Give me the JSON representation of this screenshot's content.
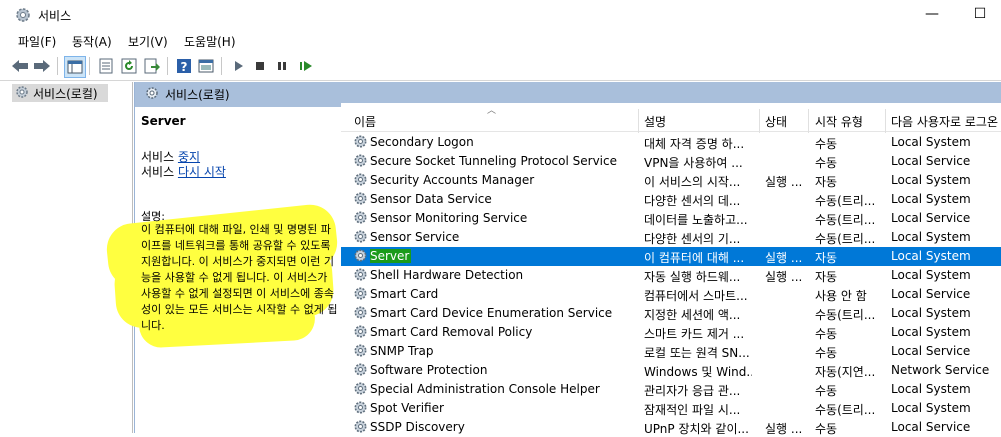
{
  "window": {
    "title": "서비스",
    "minimize": "—",
    "maximize": "☐"
  },
  "menu": [
    "파일(F)",
    "동작(A)",
    "보기(V)",
    "도움말(H)"
  ],
  "toolbar_icons": [
    "back-arrow-icon",
    "forward-arrow-icon",
    "console-tree-icon",
    "properties-icon",
    "refresh-icon",
    "export-icon",
    "help-icon",
    "view-icon",
    "play-icon",
    "stop-icon",
    "pause-icon",
    "resume-icon"
  ],
  "tree": {
    "item": "서비스(로컬)"
  },
  "pane": {
    "header": "서비스(로컬)"
  },
  "details": {
    "title": "Server",
    "line1_prefix": "서비스 ",
    "line1_link": "중지",
    "line2_prefix": "서비스 ",
    "line2_link": "다시 시작",
    "desc_label": "설명:",
    "desc_text": "이 컴퓨터에 대해 파일, 인쇄 및 명명된 파이프를 네트워크를 통해 공유할 수 있도록 지원합니다. 이 서비스가 중지되면 이런 기능을 사용할 수 없게 됩니다. 이 서비스가 사용할 수 없게 설정되면 이 서비스에 종속성이 있는 모든 서비스는 시작할 수 없게 됩니다."
  },
  "list": {
    "headers": {
      "name": "이름",
      "desc": "설명",
      "status": "상태",
      "start": "시작 유형",
      "logon": "다음 사용자로 로그온"
    },
    "rows": [
      {
        "name": "Secondary Logon",
        "desc": "대체 자격 증명 하...",
        "status": "",
        "start": "수동",
        "logon": "Local System"
      },
      {
        "name": "Secure Socket Tunneling Protocol Service",
        "desc": "VPN을 사용하여 ...",
        "status": "",
        "start": "수동",
        "logon": "Local Service"
      },
      {
        "name": "Security Accounts Manager",
        "desc": "이 서비스의 시작...",
        "status": "실행 ...",
        "start": "자동",
        "logon": "Local System"
      },
      {
        "name": "Sensor Data Service",
        "desc": "다양한 센서의 데...",
        "status": "",
        "start": "수동(트리...",
        "logon": "Local System"
      },
      {
        "name": "Sensor Monitoring Service",
        "desc": "데이터를 노출하고...",
        "status": "",
        "start": "수동(트리...",
        "logon": "Local Service"
      },
      {
        "name": "Sensor Service",
        "desc": "다양한 센서의 기...",
        "status": "",
        "start": "수동(트리...",
        "logon": "Local System"
      },
      {
        "name": "Server",
        "desc": "이 컴퓨터에 대해 ...",
        "status": "실행 ...",
        "start": "자동",
        "logon": "Local System",
        "selected": true
      },
      {
        "name": "Shell Hardware Detection",
        "desc": "자동 실행 하드웨...",
        "status": "실행 ...",
        "start": "자동",
        "logon": "Local System"
      },
      {
        "name": "Smart Card",
        "desc": "컴퓨터에서 스마트...",
        "status": "",
        "start": "사용 안 함",
        "logon": "Local Service"
      },
      {
        "name": "Smart Card Device Enumeration Service",
        "desc": "지정한 세션에 액...",
        "status": "",
        "start": "수동(트리...",
        "logon": "Local System"
      },
      {
        "name": "Smart Card Removal Policy",
        "desc": "스마트 카드 제거 ...",
        "status": "",
        "start": "수동",
        "logon": "Local System"
      },
      {
        "name": "SNMP Trap",
        "desc": "로컬 또는 원격 SN...",
        "status": "",
        "start": "수동",
        "logon": "Local Service"
      },
      {
        "name": "Software Protection",
        "desc": "Windows 및 Wind...",
        "status": "",
        "start": "자동(지연...",
        "logon": "Network Service"
      },
      {
        "name": "Special Administration Console Helper",
        "desc": "관리자가 응급 관...",
        "status": "",
        "start": "수동",
        "logon": "Local System"
      },
      {
        "name": "Spot Verifier",
        "desc": "잠재적인 파일 시...",
        "status": "",
        "start": "수동(트리...",
        "logon": "Local System"
      },
      {
        "name": "SSDP Discovery",
        "desc": "UPnP 장치와 같이...",
        "status": "실행 ...",
        "start": "수동",
        "logon": "Local Service"
      }
    ]
  },
  "colors": {
    "selection": "#0078d7",
    "pane_header": "#a9bfdb",
    "marker": "#ffff40",
    "name_highlight": "#1a9b1a"
  }
}
